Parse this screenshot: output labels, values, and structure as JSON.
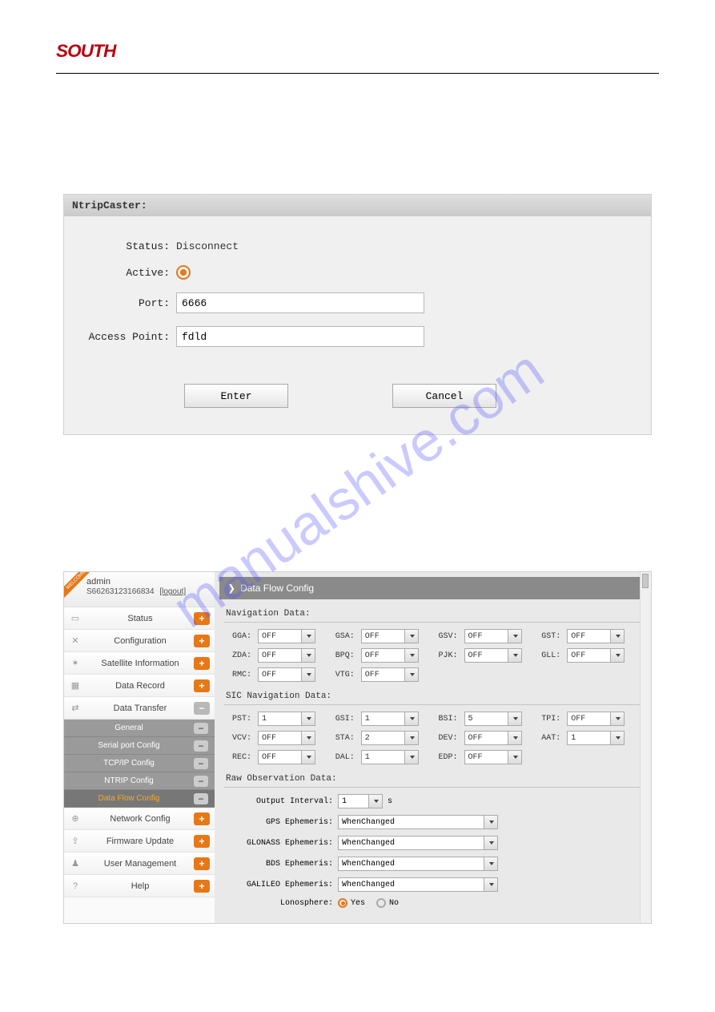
{
  "logo_text": "SOUTH",
  "watermark": "manualshive.com",
  "ntrip": {
    "title": "NtripCaster:",
    "status_label": "Status:",
    "status_value": "Disconnect",
    "active_label": "Active:",
    "port_label": "Port:",
    "port_value": "6666",
    "ap_label": "Access Point:",
    "ap_value": "fdld",
    "enter": "Enter",
    "cancel": "Cancel"
  },
  "admin": {
    "user": "admin",
    "serial": "S66263123166834",
    "logout": "[logout]"
  },
  "menu": {
    "status": "Status",
    "configuration": "Configuration",
    "satellite": "Satellite Information",
    "datarecord": "Data Record",
    "datatransfer": "Data Transfer",
    "general": "General",
    "serial": "Serial port Config",
    "tcpip": "TCP/IP Config",
    "ntrip": "NTRIP Config",
    "dataflow": "Data Flow Config",
    "network": "Network Config",
    "firmware": "Firmware Update",
    "usermgmt": "User Management",
    "help": "Help"
  },
  "main": {
    "title": "Data Flow Config",
    "nav_title": "Navigation Data:",
    "nav": {
      "GGA": "OFF",
      "GSA": "OFF",
      "GSV": "OFF",
      "GST": "OFF",
      "ZDA": "OFF",
      "BPQ": "OFF",
      "PJK": "OFF",
      "GLL": "OFF",
      "RMC": "OFF",
      "VTG": "OFF"
    },
    "sic_title": "SIC Navigation Data:",
    "sic": {
      "PST": "1",
      "GSI": "1",
      "BSI": "5",
      "TPI": "OFF",
      "VCV": "OFF",
      "STA": "2",
      "DEV": "OFF",
      "AAT": "1",
      "REC": "OFF",
      "DAL": "1",
      "EDP": "OFF"
    },
    "raw_title": "Raw Observation Data:",
    "raw": {
      "interval_label": "Output Interval:",
      "interval_value": "1",
      "interval_unit": "s",
      "gps_label": "GPS Ephemeris:",
      "gps_value": "WhenChanged",
      "glonass_label": "GLONASS Ephemeris:",
      "glonass_value": "WhenChanged",
      "bds_label": "BDS Ephemeris:",
      "bds_value": "WhenChanged",
      "galileo_label": "GALILEO Ephemeris:",
      "galileo_value": "WhenChanged",
      "iono_label": "Lonosphere:",
      "yes": "Yes",
      "no": "No"
    }
  }
}
